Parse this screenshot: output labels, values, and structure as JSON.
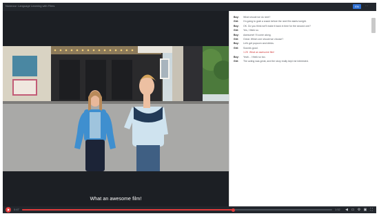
{
  "window": {
    "title": "Nowrooz: Language Learning with Films",
    "lang_label": "EN",
    "more_label": "⋯"
  },
  "video": {
    "subtitle": "What an awesome film!"
  },
  "transcript": {
    "lines": [
      {
        "speaker": "Boy:",
        "text": "What should we do next?"
      },
      {
        "speaker": "Girl:",
        "text": "I'm going to grab a snack before the next film starts tonight."
      },
      {
        "speaker": "Boy:",
        "text": "OK. Do you think we'll make it back in time for the second one?"
      },
      {
        "speaker": "Girl:",
        "text": "Yes, I think so."
      },
      {
        "speaker": "Boy:",
        "text": "Awesome! I'll come along."
      },
      {
        "speaker": "Girl:",
        "text": "Great. Which one should we choose?"
      },
      {
        "speaker": "Boy:",
        "text": "Let's get popcorn and drinks."
      },
      {
        "speaker": "Girl:",
        "text": "Sounds good."
      },
      {
        "speaker": "",
        "time": "1:25",
        "text": "",
        "highlight": "What an awesome film!"
      },
      {
        "speaker": "Boy:",
        "text": "Yeah... I think so too."
      },
      {
        "speaker": "Girl:",
        "text": "The acting was great, and the story really kept me interested."
      }
    ]
  },
  "player": {
    "current_time": "0:47",
    "duration": "1:52",
    "progress": 0.68
  }
}
